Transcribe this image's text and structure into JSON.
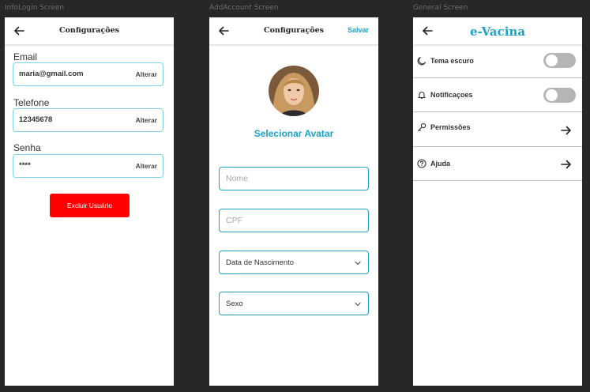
{
  "frames": {
    "infologin": "InfoLogin Screen",
    "addaccount": "AddAccount Screen",
    "general": "General Screen"
  },
  "infologin": {
    "title": "Configurações",
    "email": {
      "label": "Email",
      "value": "maria@gmail.com",
      "action": "Alterar"
    },
    "phone": {
      "label": "Telefone",
      "value": "12345678",
      "action": "Alterar"
    },
    "password": {
      "label": "Senha",
      "value": "****",
      "action": "Alterar"
    },
    "delete_button": "Excluir Usuário"
  },
  "addaccount": {
    "title": "Configurações",
    "save": "Salvar",
    "select_avatar": "Selecionar Avatar",
    "name_placeholder": "Nome",
    "cpf_placeholder": "CPF",
    "birth_select": "Data de Nascimento",
    "sex_select": "Sexo"
  },
  "general": {
    "brand": "e-Vacina",
    "items": [
      {
        "label": "Tema escuro",
        "icon": "moon-icon",
        "control": "toggle",
        "on": false
      },
      {
        "label": "Notificaçoes",
        "icon": "bell-icon",
        "control": "toggle",
        "on": false
      },
      {
        "label": "Permissões",
        "icon": "key-icon",
        "control": "arrow"
      },
      {
        "label": "Ajuda",
        "icon": "help-icon",
        "control": "arrow"
      }
    ]
  },
  "colors": {
    "accent": "#1aa3c9",
    "danger": "#ff0000",
    "background": "#272727"
  }
}
